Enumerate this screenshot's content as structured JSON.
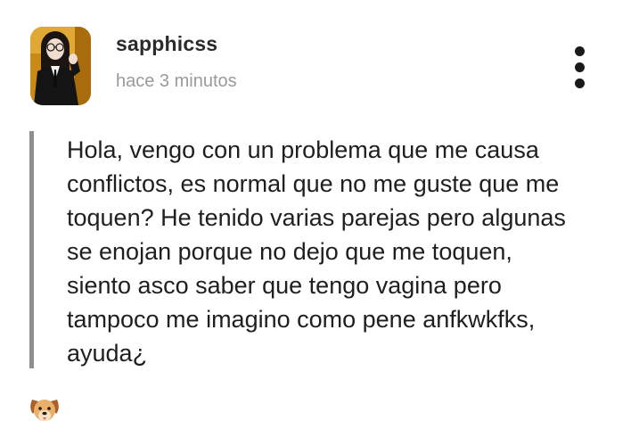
{
  "post": {
    "author": {
      "username": "sapphicss",
      "avatar_icon": "user-avatar-photo"
    },
    "timestamp": "hace 3 minutos",
    "menu_icon": "more-vertical-icon",
    "body": "Hola, vengo con un problema que me causa\nconflictos, es normal que no me guste que me\ntoquen? He tenido varias parejas pero algunas\nse enojan porque no dejo que me toquen,\nsiento asco saber que tengo vagina pero\ntampoco me imagino como pene anfkwkfks,\nayuda¿",
    "reaction": {
      "icon": "dog-face-emoji"
    }
  },
  "colors": {
    "username": "#2b2b2b",
    "timestamp": "#9a9a9a",
    "body_text": "#1f1f1f",
    "quote_bar": "#8f8f8f",
    "avatar_background": "#c98a16"
  }
}
